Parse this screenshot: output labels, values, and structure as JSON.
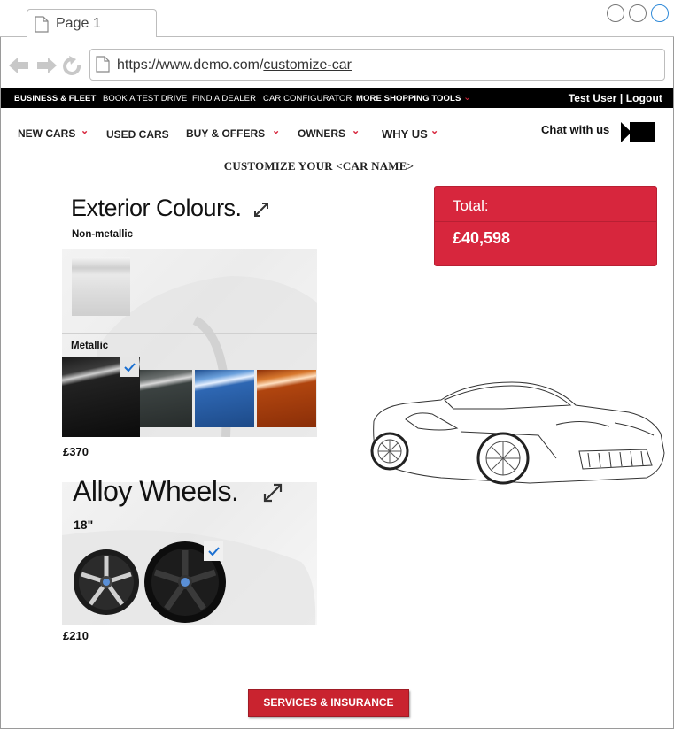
{
  "browser": {
    "tab_label": "Page 1",
    "url_prefix": "https://www.demo.com/",
    "url_path": "customize-car"
  },
  "topnav": {
    "items": [
      "BUSINESS & FLEET",
      "BOOK A TEST DRIVE",
      "FIND A DEALER",
      "CAR CONFIGURATOR",
      "MORE SHOPPING TOOLS"
    ],
    "caret": "⌄",
    "user": "Test User | Logout"
  },
  "mainnav": {
    "items": [
      "NEW CARS",
      "USED CARS",
      "BUY & OFFERS",
      "OWNERS",
      "WHY US"
    ],
    "caret": "⌄",
    "chat": "Chat with us"
  },
  "page": {
    "heading": "CUSTOMIZE YOUR <CAR NAME>"
  },
  "exterior": {
    "title": "Exterior Colours.",
    "nonmetallic_label": "Non-metallic",
    "metallic_label": "Metallic",
    "price": "£370",
    "swatch_colors": [
      "#d6d6d6",
      "#111111",
      "#2b302f",
      "#2b5ea8",
      "#a83d10"
    ]
  },
  "wheels": {
    "title": "Alloy Wheels.",
    "size_label": "18\"",
    "price": "£210"
  },
  "total": {
    "label": "Total:",
    "value": "£40,598"
  },
  "cta": {
    "label": "SERVICES & INSURANCE"
  },
  "colors": {
    "accent": "#d7263d",
    "check": "#1a6fd1"
  }
}
